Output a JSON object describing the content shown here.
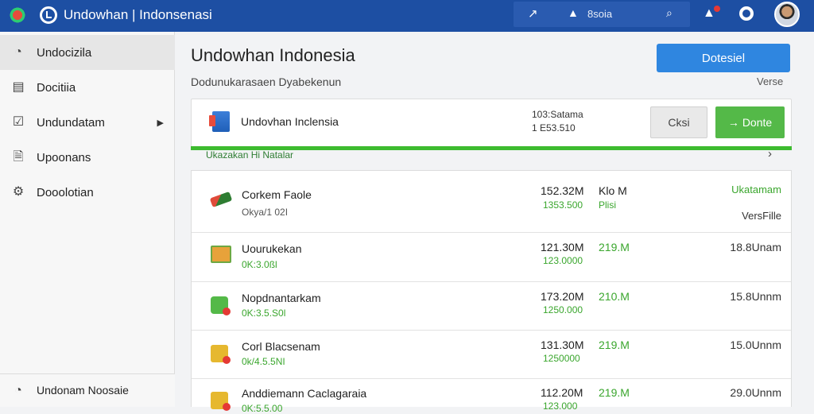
{
  "app": {
    "title": "Undowhan | Indonsenasi"
  },
  "topbar": {
    "search_label": "8soia",
    "icons": [
      "pin-icon",
      "bell-icon",
      "search-icon",
      "notification-icon",
      "settings-icon",
      "avatar"
    ]
  },
  "sidebar": {
    "items": [
      {
        "label": "Undocizila",
        "icon": "dashboard-icon",
        "active": true
      },
      {
        "label": "Docitiia",
        "icon": "document-icon"
      },
      {
        "label": "Undundatam",
        "icon": "checkbox-icon",
        "has_submenu": true
      },
      {
        "label": "Upoonans",
        "icon": "clipboard-icon"
      },
      {
        "label": "Dooolotian",
        "icon": "gear-icon"
      }
    ],
    "footer_label": "Undonam Noosaie"
  },
  "main": {
    "title": "Undowhan Indonesia",
    "subtitle": "Dodunukarasaen Dyabekenun",
    "primary_button": "Dotesiel",
    "version_link": "Verse",
    "featured": {
      "title": "Undovhan Inclensia",
      "size_line1": "103:Satama",
      "size_line2": "1 E53.510",
      "secondary_button": "Cksi",
      "done_button": "Donte",
      "done_icon": "arrow-right-icon"
    },
    "progress": {
      "text": "Ukazakan Hi Natalar",
      "value": 100
    },
    "rows": [
      {
        "name": "Corkem Faole",
        "sub": "Okya/1 02I",
        "size": "152.32M",
        "size2": "1353.500",
        "rate": "Klo M",
        "rate2": "Plisi",
        "status": "Ukatamam",
        "status_green": true,
        "status2": "VersFille",
        "icon": "disk-icon"
      },
      {
        "name": "Uourukekan",
        "sub": "0K:3.0ßl",
        "size": "121.30M",
        "size2": "123.0000",
        "rate": "219.M",
        "status": "18.8Unam",
        "icon": "package-icon"
      },
      {
        "name": "Nopdnantarkam",
        "sub": "0K:3.5.S0l",
        "size": "173.20M",
        "size2": "1250.000",
        "rate": "210.M",
        "status": "15.8Unnm",
        "icon": "shield-icon"
      },
      {
        "name": "Corl Blacsenam",
        "sub": "0k/4.5.5NI",
        "size": "131.30M",
        "size2": "1250000",
        "rate": "219.M",
        "status": "15.0Unnm",
        "icon": "lock-icon"
      },
      {
        "name": "Anddiemann Caclagaraia",
        "sub": "0K:5.5.00",
        "size": "112.20M",
        "size2": "123.000",
        "rate": "219.M",
        "status": "29.0Unnm",
        "icon": "lock-icon"
      }
    ]
  }
}
